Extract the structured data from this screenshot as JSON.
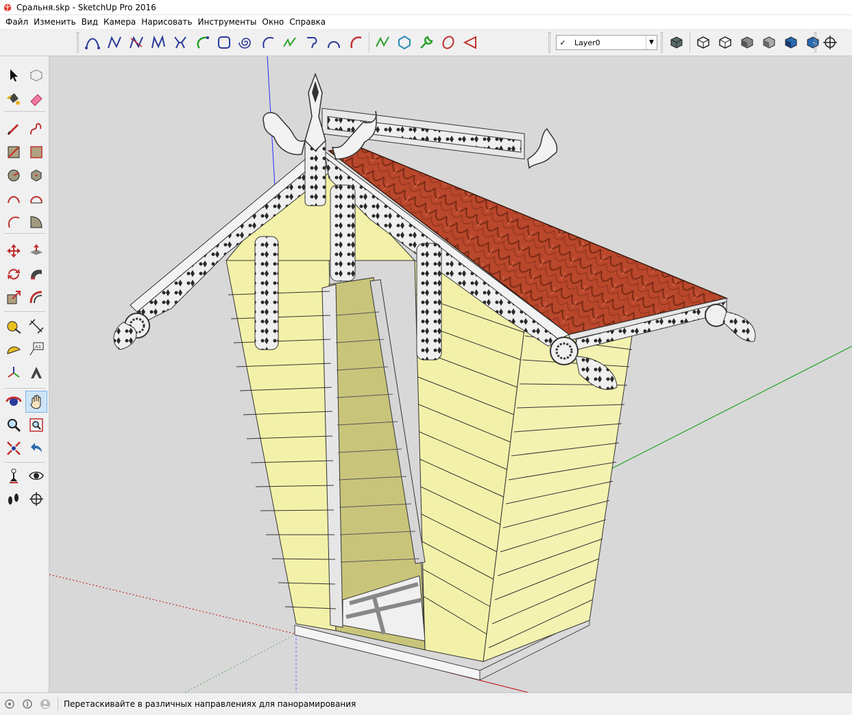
{
  "window": {
    "title": "Сральня.skp - SketchUp Pro 2016",
    "app_icon": "sketchup-logo-icon"
  },
  "menu": {
    "items": [
      "Файл",
      "Изменить",
      "Вид",
      "Камера",
      "Нарисовать",
      "Инструменты",
      "Окно",
      "Справка"
    ]
  },
  "toolbar": {
    "draw_tools": [
      "bezier-curve-icon",
      "polyline-icon",
      "spline-icon",
      "freehand-spline-icon",
      "catenary-icon",
      "arc-icon",
      "rounded-rect-icon",
      "spiral-icon",
      "arc-3pt-icon",
      "zigzag-icon",
      "hook-curve-icon",
      "half-arc-icon",
      "red-arc-icon",
      "bspline-icon",
      "polygon-icon",
      "wrench-icon",
      "ellipse-icon",
      "cone-icon"
    ],
    "layer": {
      "selected": "Layer0"
    },
    "style_tools": [
      "xray-style-icon",
      "wireframe-style-icon",
      "hidden-line-style-icon",
      "shaded-style-icon",
      "shaded-texture-style-icon",
      "monochrome-style-icon",
      "back-edges-style-icon"
    ],
    "extra_tools": [
      "section-plane-icon"
    ]
  },
  "left_tools": {
    "group1": [
      "select-icon",
      "make-component-icon",
      "paint-bucket-icon",
      "eraser-icon"
    ],
    "group2": [
      "pencil-icon",
      "freehand-icon",
      "rectangle-icon",
      "rotated-rectangle-icon",
      "circle-icon",
      "polygon-tool-icon",
      "arc-icon",
      "two-point-arc-icon",
      "three-point-arc-icon",
      "pie-icon"
    ],
    "group3": [
      "move-icon",
      "push-pull-icon",
      "rotate-icon",
      "follow-me-icon",
      "scale-icon",
      "offset-icon"
    ],
    "group4": [
      "tape-measure-icon",
      "dimension-icon",
      "protractor-icon",
      "text-icon",
      "axes-icon",
      "3d-text-icon"
    ],
    "group5": [
      "orbit-icon",
      "pan-icon",
      "zoom-icon",
      "zoom-window-icon",
      "zoom-extents-icon",
      "previous-view-icon"
    ],
    "group6": [
      "position-camera-icon",
      "look-around-icon",
      "walk-icon",
      "section-icon"
    ],
    "active": "pan-icon"
  },
  "status": {
    "text": "Перетаскивайте в различных направлениях для панорамирования",
    "icons": [
      "geo-location-icon",
      "credits-icon",
      "user-icon"
    ]
  },
  "colors": {
    "viewport_bg": "#d8d8d8",
    "wall": "#f3f1a9",
    "wall_shadow": "#c8c57a",
    "roof": "#b8472c",
    "trim": "#f2f2f2",
    "axis_red": "#c00000",
    "axis_green": "#00a000",
    "axis_blue": "#1a1aff"
  }
}
